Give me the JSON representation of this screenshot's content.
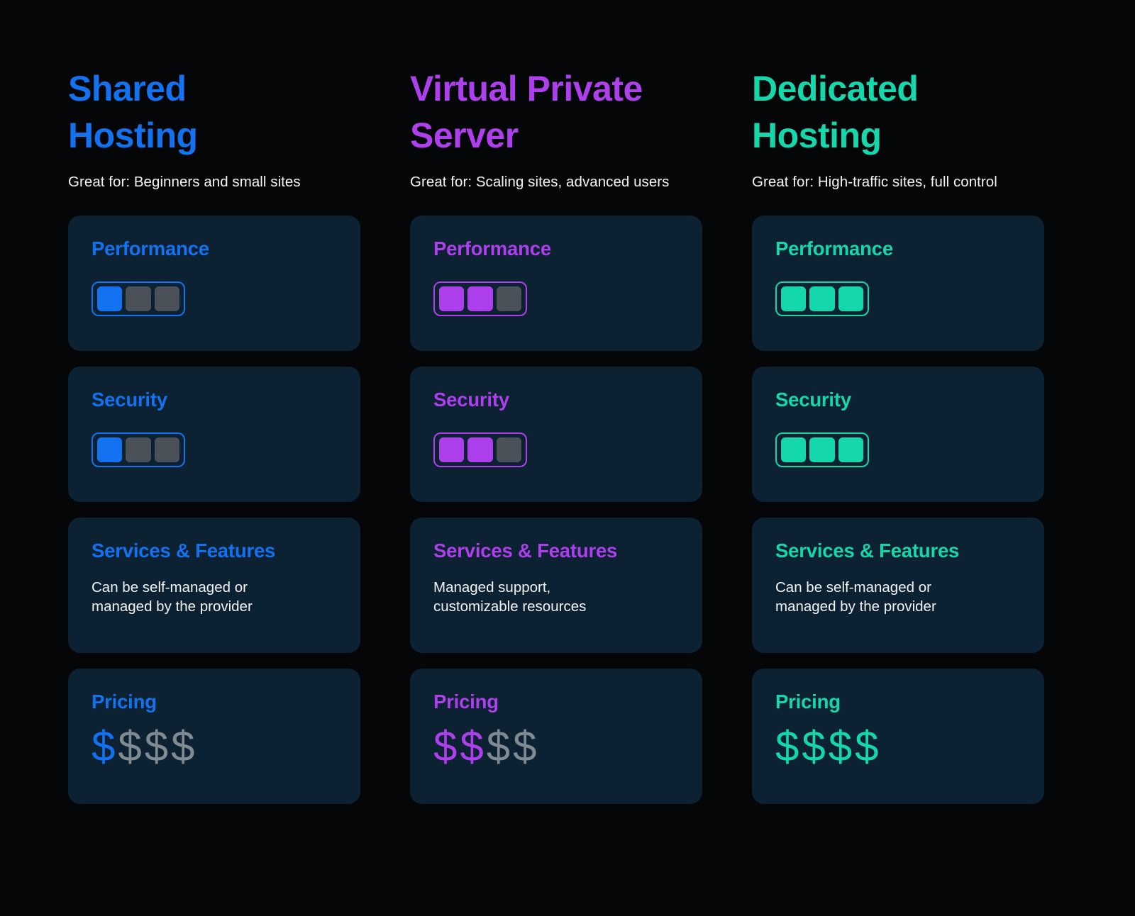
{
  "page": {
    "background": "#050608",
    "card_background": "#0c2131",
    "muted_text": "#f2f4f6",
    "inactive_color": "#4a5159",
    "inactive_dollar_color": "#808a91"
  },
  "columns": [
    {
      "id": "shared-hosting",
      "title": "Shared\nHosting",
      "accent": "#1272F0",
      "subtitle": "Great for: Beginners and small sites",
      "cards": [
        {
          "id": "performance",
          "type": "meter",
          "title": "Performance",
          "segments_total": 3,
          "segments_filled": 1
        },
        {
          "id": "security",
          "type": "meter",
          "title": "Security",
          "segments_total": 3,
          "segments_filled": 1
        },
        {
          "id": "services-features",
          "type": "text",
          "title": "Services & Features",
          "description": "Can be self-managed or\nmanaged by the provider"
        },
        {
          "id": "pricing",
          "type": "price",
          "title": "Pricing",
          "symbol": "$",
          "symbols_total": 4,
          "symbols_filled": 1
        }
      ]
    },
    {
      "id": "virtual-private-server",
      "title": "Virtual Private\nServer",
      "accent": "#AD3FEC",
      "subtitle": "Great for: Scaling sites, advanced users",
      "cards": [
        {
          "id": "performance",
          "type": "meter",
          "title": "Performance",
          "segments_total": 3,
          "segments_filled": 2
        },
        {
          "id": "security",
          "type": "meter",
          "title": "Security",
          "segments_total": 3,
          "segments_filled": 2
        },
        {
          "id": "services-features",
          "type": "text",
          "title": "Services & Features",
          "description": "Managed support,\ncustomizable resources"
        },
        {
          "id": "pricing",
          "type": "price",
          "title": "Pricing",
          "symbol": "$",
          "symbols_total": 4,
          "symbols_filled": 2
        }
      ]
    },
    {
      "id": "dedicated-hosting",
      "title": "Dedicated\nHosting",
      "accent": "#14D8AC",
      "subtitle": "Great for: High-traffic sites, full control",
      "cards": [
        {
          "id": "performance",
          "type": "meter",
          "title": "Performance",
          "segments_total": 3,
          "segments_filled": 3
        },
        {
          "id": "security",
          "type": "meter",
          "title": "Security",
          "segments_total": 3,
          "segments_filled": 3
        },
        {
          "id": "services-features",
          "type": "text",
          "title": "Services & Features",
          "description": "Can be self-managed or\nmanaged by the provider"
        },
        {
          "id": "pricing",
          "type": "price",
          "title": "Pricing",
          "symbol": "$",
          "symbols_total": 4,
          "symbols_filled": 4
        }
      ]
    }
  ]
}
